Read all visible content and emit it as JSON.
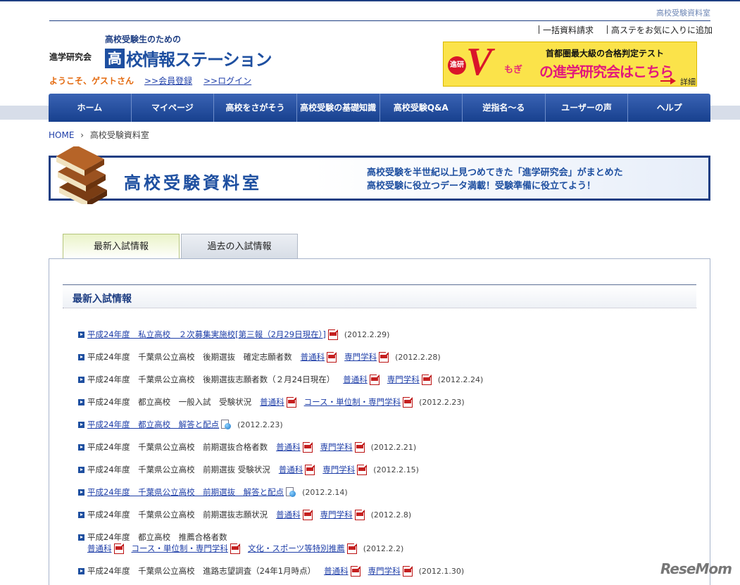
{
  "top": {
    "section_title": "高校受験資料室"
  },
  "logo": {
    "subtitle": "高校受験生のための",
    "org": "進学研究会",
    "box_char": "高",
    "main_rest": "校情報ステーション"
  },
  "welcome": {
    "greeting": "ようこそ、ゲストさん",
    "register": ">>会員登録",
    "login": ">>ログイン"
  },
  "utility": {
    "bulk": "一括資料請求",
    "favorite": "高ステをお気に入りに追加"
  },
  "banner": {
    "badge": "進研",
    "big_letter": "V",
    "v_sub": "もぎ",
    "line1": "首都圏最大級の合格判定テスト",
    "line2": "の進学研究会はこちら",
    "detail": "詳細"
  },
  "nav": [
    "ホーム",
    "マイページ",
    "高校をさがそう",
    "高校受験の基礎知識",
    "高校受験Q&A",
    "逆指名～る",
    "ユーザーの声",
    "ヘルプ"
  ],
  "breadcrumb": {
    "home": "HOME",
    "sep": "›",
    "current": "高校受験資料室"
  },
  "hero": {
    "title": "高校受験資料室",
    "desc1": "高校受験を半世紀以上見つめてきた「進学研究会」がまとめた",
    "desc2": "高校受験に役立つデータ満載！受験準備に役立てよう！"
  },
  "tabs": {
    "latest": "最新入試情報",
    "past": "過去の入試情報"
  },
  "section": {
    "heading": "最新入試情報"
  },
  "items": {
    "i1": {
      "link": "平成24年度　私立高校　２次募集実施校[第三報（2月29日現在）]",
      "date": "(2012.2.29)"
    },
    "i2": {
      "text": "平成24年度　千葉県公立高校　後期選抜　確定志願者数",
      "l1": "普通科",
      "l2": "専門学科",
      "date": "(2012.2.28)"
    },
    "i3": {
      "text": "平成24年度　千葉県公立高校　後期選抜志願者数（２月24日現在）",
      "l1": "普通科",
      "l2": "専門学科",
      "date": "(2012.2.24)"
    },
    "i4": {
      "text": "平成24年度　都立高校　一般入試　受験状況",
      "l1": "普通科",
      "l2": "コース・単位制・専門学科",
      "date": "(2012.2.23)"
    },
    "i5": {
      "link": "平成24年度　都立高校　解答と配点",
      "date": "(2012.2.23)"
    },
    "i6": {
      "text": "平成24年度　千葉県公立高校　前期選抜合格者数",
      "l1": "普通科",
      "l2": "専門学科",
      "date": "(2012.2.21)"
    },
    "i7": {
      "text": "平成24年度　千葉県公立高校　前期選抜 受験状況",
      "l1": "普通科",
      "l2": "専門学科",
      "date": "(2012.2.15)"
    },
    "i8": {
      "link": "平成24年度　千葉県公立高校　前期選抜　解答と配点",
      "date": "(2012.2.14)"
    },
    "i9": {
      "text": "平成24年度　千葉県公立高校　前期選抜志願状況",
      "l1": "普通科",
      "l2": "専門学科",
      "date": "(2012.2.8)"
    },
    "i10": {
      "text": "平成24年度　都立高校　推薦合格者数",
      "l1": "普通科",
      "l2": "コース・単位制・専門学科",
      "l3": "文化・スポーツ等特別推薦",
      "date": "(2012.2.2)"
    },
    "i11": {
      "text": "平成24年度　千葉県公立高校　進路志望調査（24年1月時点）",
      "l1": "普通科",
      "l2": "専門学科",
      "date": "(2012.1.30)"
    }
  },
  "watermark": "ReseMom"
}
